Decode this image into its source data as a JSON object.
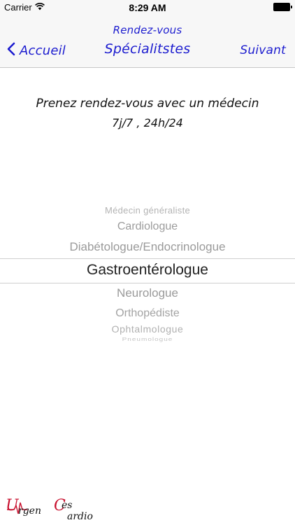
{
  "status_bar": {
    "carrier": "Carrier",
    "time": "8:29 AM"
  },
  "nav": {
    "subtitle": "Rendez-vous",
    "title": "Spécialitstes",
    "back_label": "Accueil",
    "next_label": "Suivant",
    "accent_color": "#1c1ccf"
  },
  "intro": {
    "line1": "Prenez rendez-vous avec un médecin",
    "line2": "7j/7 , 24h/24"
  },
  "picker": {
    "options": [
      "Médecin généraliste",
      "Cardiologue",
      "Diabétologue/Endocrinologue",
      "Gastroentérologue",
      "Neurologue",
      "Orthopédiste",
      "Ophtalmologue",
      "Pneumologue"
    ],
    "selected": "Gastroentérologue"
  },
  "logo": {
    "text": "Urgences Cardio",
    "brand_color": "#c8102e"
  }
}
